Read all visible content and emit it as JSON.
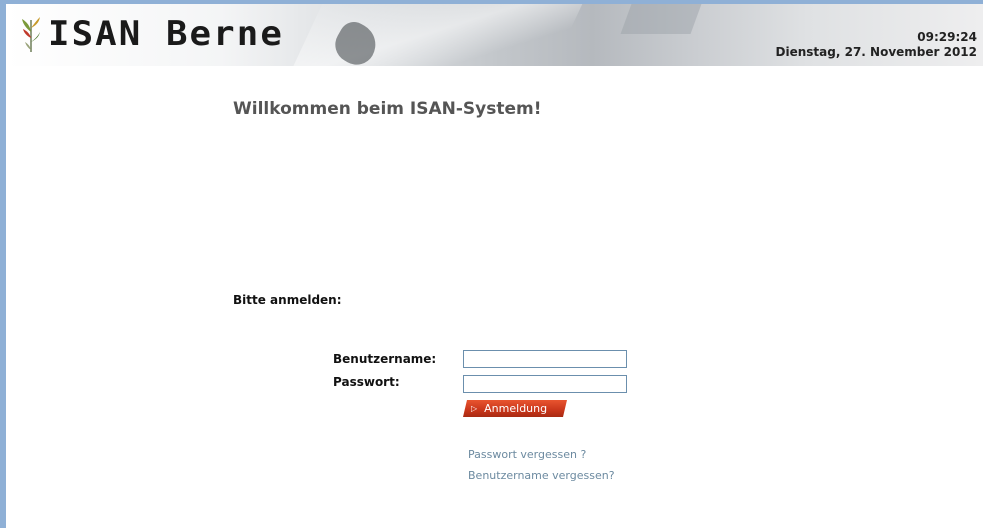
{
  "header": {
    "logo_text": "ISAN Berne",
    "logo_icon": "plant-logo-icon",
    "time": "09:29:24",
    "date": "Dienstag, 27. November 2012"
  },
  "main": {
    "welcome_title": "Willkommen beim ISAN-System!",
    "login_prompt": "Bitte anmelden:"
  },
  "form": {
    "username_label": "Benutzername:",
    "username_value": "",
    "password_label": "Passwort:",
    "password_value": "",
    "login_button_label": "Anmeldung",
    "login_button_icon": "play-arrow-icon"
  },
  "links": {
    "forgot_password": "Passwort vergessen ?",
    "forgot_username": "Benutzername vergessen?"
  },
  "colors": {
    "frame": "#8fb0d6",
    "button": "#c9361a",
    "link": "#6c8aa0",
    "title": "#555555"
  }
}
